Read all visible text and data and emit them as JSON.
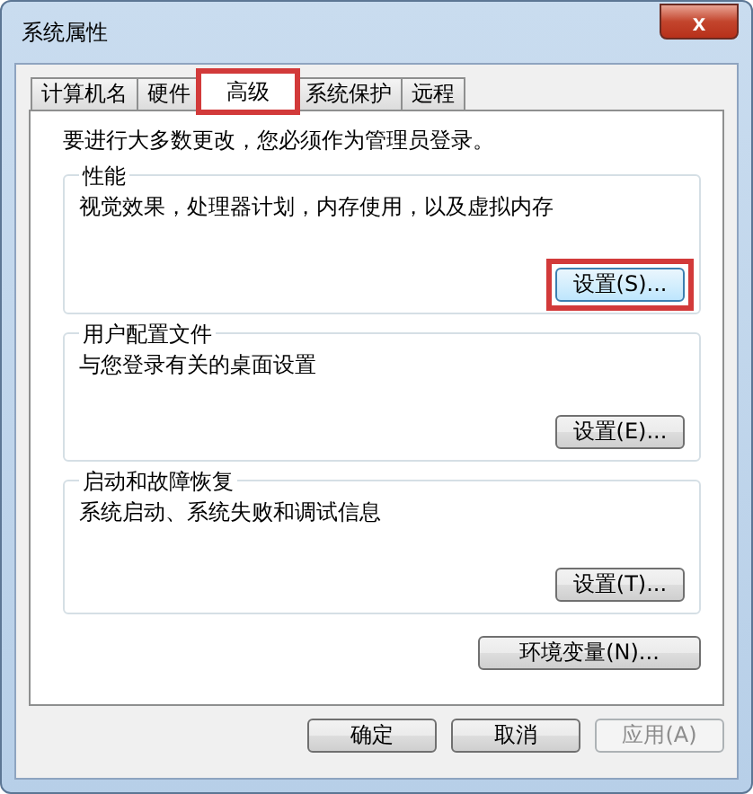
{
  "window": {
    "title": "系统属性",
    "close": "x"
  },
  "tabs": [
    {
      "label": "计算机名",
      "selected": false,
      "highlighted": false
    },
    {
      "label": "硬件",
      "selected": false,
      "highlighted": false
    },
    {
      "label": "高级",
      "selected": true,
      "highlighted": true
    },
    {
      "label": "系统保护",
      "selected": false,
      "highlighted": false
    },
    {
      "label": "远程",
      "selected": false,
      "highlighted": false
    }
  ],
  "notice": "要进行大多数更改，您必须作为管理员登录。",
  "groups": [
    {
      "title": "性能",
      "description": "视觉效果，处理器计划，内存使用，以及虚拟内存",
      "button": "设置(S)...",
      "button_highlighted": true,
      "button_focused": true
    },
    {
      "title": "用户配置文件",
      "description": "与您登录有关的桌面设置",
      "button": "设置(E)...",
      "button_highlighted": false,
      "button_focused": false
    },
    {
      "title": "启动和故障恢复",
      "description": "系统启动、系统失败和调试信息",
      "button": "设置(T)...",
      "button_highlighted": false,
      "button_focused": false
    }
  ],
  "env_button": "环境变量(N)...",
  "footer_buttons": [
    {
      "label": "确定",
      "disabled": false
    },
    {
      "label": "取消",
      "disabled": false
    },
    {
      "label": "应用(A)",
      "disabled": true
    }
  ]
}
